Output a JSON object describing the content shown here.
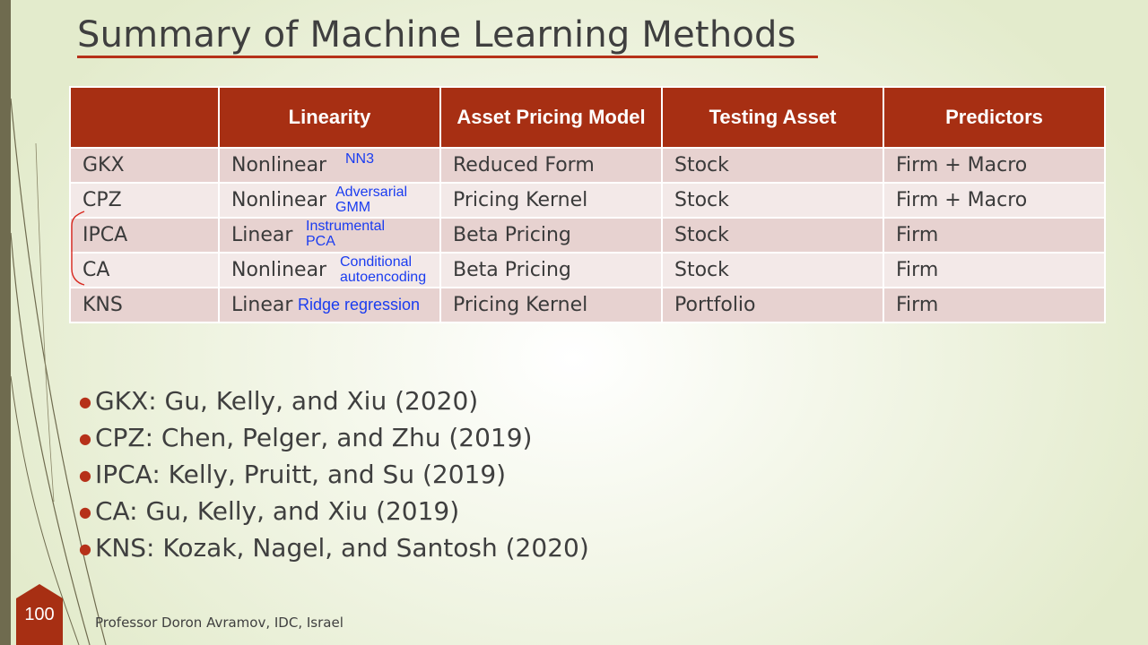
{
  "slide": {
    "title": "Summary of Machine Learning Methods",
    "page_number": "100",
    "footer": "Professor Doron Avramov, IDC, Israel"
  },
  "table": {
    "headers": [
      "",
      "Linearity",
      "Asset Pricing Model",
      "Testing Asset",
      "Predictors"
    ],
    "rows": [
      {
        "method": "GKX",
        "linearity": "Nonlinear",
        "note": "NN3",
        "model": "Reduced Form",
        "asset": "Stock",
        "predictors": "Firm + Macro"
      },
      {
        "method": "CPZ",
        "linearity": "Nonlinear",
        "note": "Adversarial GMM",
        "model": "Pricing Kernel",
        "asset": "Stock",
        "predictors": "Firm + Macro"
      },
      {
        "method": "IPCA",
        "linearity": "Linear",
        "note": "Instrumental PCA",
        "model": "Beta Pricing",
        "asset": "Stock",
        "predictors": "Firm"
      },
      {
        "method": "CA",
        "linearity": "Nonlinear",
        "note": "Conditional autoencoding",
        "model": "Beta Pricing",
        "asset": "Stock",
        "predictors": "Firm"
      },
      {
        "method": "KNS",
        "linearity": "Linear",
        "note": "Ridge regression",
        "model": "Pricing Kernel",
        "asset": "Portfolio",
        "predictors": "Firm"
      }
    ]
  },
  "annotations": {
    "gkx": "NN3",
    "cpz_line1": "Adversarial",
    "cpz_line2": "GMM",
    "ipca_line1": "Instrumental",
    "ipca_line2": "PCA",
    "ca_line1": "Conditional",
    "ca_line2": "autoencoding",
    "kns": "Ridge regression"
  },
  "references": [
    "GKX: Gu, Kelly, and Xiu (2020)",
    "CPZ: Chen, Pelger, and Zhu (2019)",
    "IPCA: Kelly, Pruitt, and Su (2019)",
    "CA: Gu, Kelly, and Xiu (2019)",
    "KNS: Kozak, Nagel, and Santosh (2020)"
  ],
  "colors": {
    "header_bg": "#a72f13",
    "annotation": "#1a3cf0",
    "accent": "#b63119"
  }
}
